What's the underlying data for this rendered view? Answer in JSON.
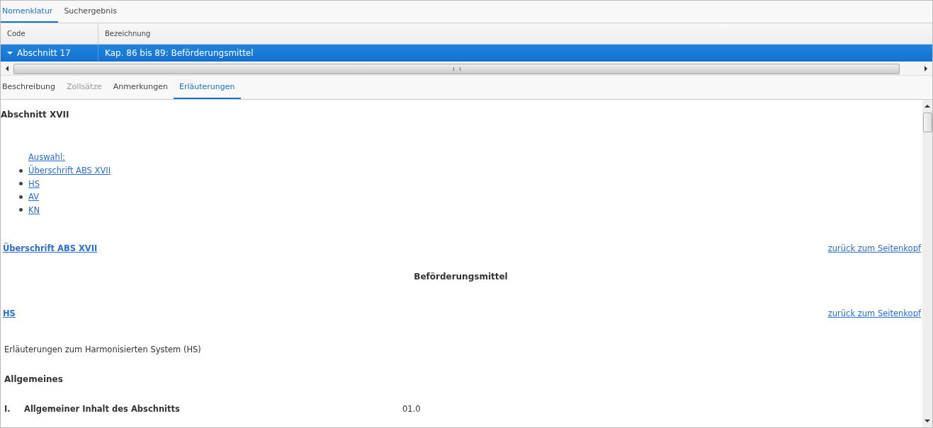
{
  "top_tabs": [
    {
      "label": "Nomenklatur",
      "selected": true
    },
    {
      "label": "Suchergebnis",
      "selected": false
    }
  ],
  "table": {
    "columns": [
      "Code",
      "Bezeichnung"
    ],
    "rows": [
      {
        "code": "Abschnitt 17",
        "description": "Kap. 86 bis 89: Beförderungsmittel",
        "expanded": true,
        "selected": true
      }
    ]
  },
  "detail_tabs": [
    {
      "label": "Beschreibung",
      "selected": false,
      "disabled": false
    },
    {
      "label": "Zollsätze",
      "selected": false,
      "disabled": true
    },
    {
      "label": "Anmerkungen",
      "selected": false,
      "disabled": false
    },
    {
      "label": "Erläuterungen",
      "selected": true,
      "disabled": false
    }
  ],
  "content": {
    "heading": "Abschnitt XVII",
    "selection": {
      "label": "Auswahl:",
      "links": [
        "Überschrift ABS XVII",
        "HS",
        "AV",
        "KN"
      ]
    },
    "blocks": [
      {
        "kind": "anchor",
        "text": "Überschrift ABS XVII",
        "back": "zurück zum Seitenkopf"
      },
      {
        "kind": "title",
        "text": "Beförderungsmittel"
      },
      {
        "kind": "anchor",
        "text": "HS",
        "back": "zurück zum Seitenkopf"
      },
      {
        "kind": "text",
        "text": "Erläuterungen zum Harmonisierten System (HS)"
      },
      {
        "kind": "bold",
        "text": "Allgemeines"
      },
      {
        "kind": "numbered",
        "number": "I.",
        "text": "Allgemeiner Inhalt des Abschnitts",
        "code": "01.0"
      }
    ]
  }
}
